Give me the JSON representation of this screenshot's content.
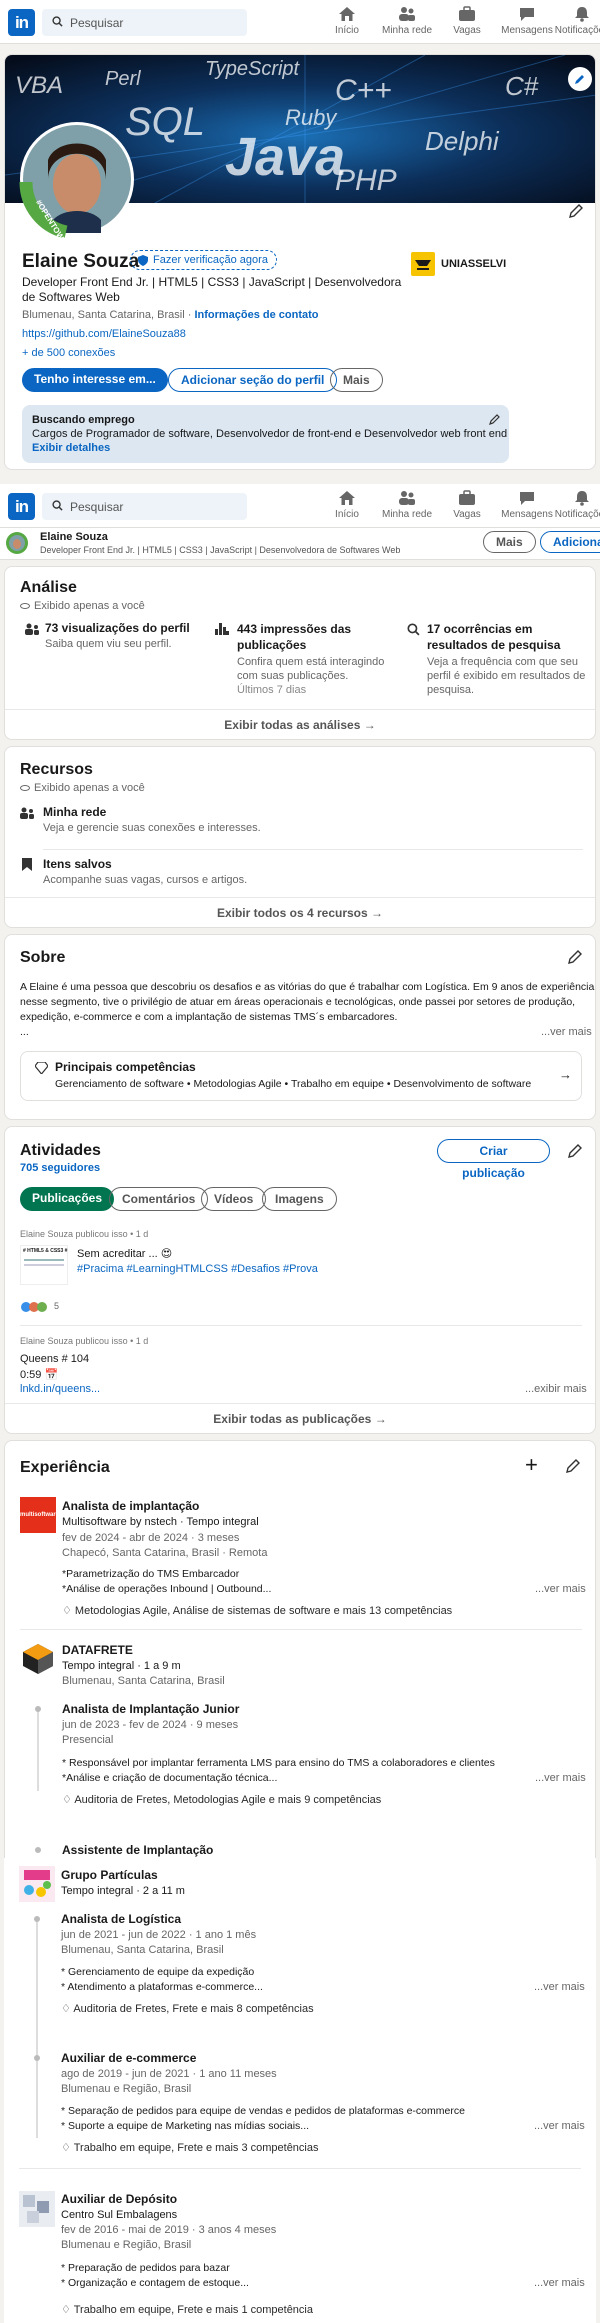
{
  "colors": {
    "brand": "#0a66c2",
    "accent_green": "#01754f",
    "background": "#f4f2ee"
  },
  "nav": {
    "logo": "in",
    "search_placeholder": "Pesquisar",
    "items": [
      {
        "label": "Início",
        "icon": "home-icon"
      },
      {
        "label": "Minha rede",
        "icon": "network-icon"
      },
      {
        "label": "Vagas",
        "icon": "briefcase-icon"
      },
      {
        "label": "Mensagens",
        "icon": "messages-icon"
      },
      {
        "label": "Notificações",
        "icon": "bell-icon"
      }
    ]
  },
  "profile": {
    "banner_words": [
      "VBA",
      "Perl",
      "TypeScript",
      "SQL",
      "Java",
      "Ruby",
      "C++",
      "PHP",
      "Delphi",
      "C#"
    ],
    "open_to_work": "#OPENTOWORK",
    "name": "Elaine Souza",
    "verify": "Fazer verificação agora",
    "headline_1": "Developer Front End Jr. | HTML5 | CSS3 | JavaScript | Desenvolvedora",
    "headline_2": "de Softwares Web",
    "location": "Blumenau, Santa Catarina, Brasil",
    "contact": "Informações de contato",
    "github": "https://github.com/ElaineSouza88",
    "connections": "+ de 500 conexões",
    "school": "UNIASSELVI",
    "btn_open": "Tenho interesse em...",
    "btn_add": "Adicionar seção do perfil",
    "btn_more": "Mais",
    "job_title": "Buscando emprego",
    "job_desc": "Cargos de Programador de software, Desenvolvedor de front-end e Desenvolvedor web front end",
    "job_link": "Exibir detalhes"
  },
  "sticky": {
    "name": "Elaine Souza",
    "headline": "Developer Front End Jr. | HTML5 | CSS3 | JavaScript | Desenvolvedora de Softwares Web",
    "more": "Mais",
    "add": "Adicionar"
  },
  "analysis": {
    "title": "Análise",
    "private": "Exibido apenas a você",
    "items": [
      {
        "title": "73 visualizações do perfil",
        "desc": "Saiba quem viu seu perfil.",
        "icon": "people-icon"
      },
      {
        "title": "443 impressões das",
        "title2": "publicações",
        "desc": "Confira quem está interagindo",
        "desc2": "com suas publicações.",
        "desc3": "Últimos 7 dias",
        "icon": "bar-chart-icon"
      },
      {
        "title": "17 ocorrências em",
        "title2": "resultados de pesquisa",
        "desc": "Veja a frequência com que seu",
        "desc2": "perfil é exibido em resultados de",
        "desc3": "pesquisa.",
        "icon": "search-icon"
      }
    ],
    "footer": "Exibir todas as análises →"
  },
  "resources": {
    "title": "Recursos",
    "private": "Exibido apenas a você",
    "items": [
      {
        "title": "Minha rede",
        "desc": "Veja e gerencie suas conexões e interesses."
      },
      {
        "title": "Itens salvos",
        "desc": "Acompanhe suas vagas, cursos e artigos."
      }
    ],
    "footer": "Exibir todos os 4 recursos →"
  },
  "about": {
    "title": "Sobre",
    "l1": "A Elaine é uma pessoa que descobriu os desafios e as vitórias do que é trabalhar com Logística. Em 9 anos de experiência",
    "l2": "nesse segmento, tive o privilégio de atuar em áreas operacionais e tecnológicas, onde passei por setores de produção,",
    "l3": "expedição, e-commerce e com a implantação de sistemas TMS´s embarcadores.",
    "l4": "...",
    "more": "...ver mais",
    "skills_title": "Principais competências",
    "skills": "Gerenciamento de software • Metodologias Agile • Trabalho em equipe • Desenvolvimento de software"
  },
  "activity": {
    "title": "Atividades",
    "followers": "705 seguidores",
    "create": "Criar publicação",
    "tabs": [
      "Publicações",
      "Comentários",
      "Vídeos",
      "Imagens"
    ],
    "p1_meta": "Elaine Souza publicou isso • 1 d",
    "p1_thumb": "# HTML5 & CSS3 #",
    "p1_text": "Sem acreditar ... 😍",
    "p1_tags": "#Pracima #LearningHTMLCSS #Desafios #Prova",
    "p1_reacts": "5",
    "p2_meta": "Elaine Souza publicou isso • 1 d",
    "p2_l1": "Queens # 104",
    "p2_l2": "0:59 📅",
    "p2_link": "lnkd.in/queens...",
    "p2_more": "...exibir mais",
    "footer": "Exibir todas as publicações →"
  },
  "experience": {
    "title": "Experiência",
    "multisoftware": {
      "logo": "multisoftware",
      "role": "Analista de implantação",
      "company": "Multisoftware by nstech · Tempo integral",
      "dates": "fev de 2024 - abr de 2024 · 3 meses",
      "place": "Chapecó, Santa Catarina, Brasil · Remota",
      "d1": "*Parametrização do TMS Embarcador",
      "d2": "*Análise de operações Inbound | Outbound...",
      "more": "...ver mais",
      "skills": "Metodologias Agile, Análise de sistemas de software e mais 13 competências"
    },
    "datafrete": {
      "company": "DATAFRETE",
      "type": "Tempo integral · 1 a 9 m",
      "place": "Blumenau, Santa Catarina, Brasil",
      "role1": "Analista de Implantação Junior",
      "dates1": "jun de 2023 - fev de 2024 · 9 meses",
      "mode1": "Presencial",
      "d1": "* Responsável por implantar ferramenta LMS para ensino do TMS a colaboradores e clientes",
      "d2": "*Análise e criação de documentação técnica...",
      "more": "...ver mais",
      "skills1": "Auditoria de Fretes, Metodologias Agile e mais 9 competências",
      "role2": "Assistente de Implantação"
    },
    "particulas": {
      "logo": "Grupo Partículas",
      "company": "Grupo Partículas",
      "type": "Tempo integral · 2 a 11 m",
      "role1": "Analista de Logística",
      "dates1": "jun de 2021 - jun de 2022 · 1 ano 1 mês",
      "place1": "Blumenau, Santa Catarina, Brasil",
      "d1a": "* Gerenciamento de equipe da expedição",
      "d1b": "* Atendimento a plataformas e-commerce...",
      "more1": "...ver mais",
      "skills1": "Auditoria de Fretes, Frete e mais 8 competências",
      "role2": "Auxiliar de e-commerce",
      "dates2": "ago de 2019 - jun de 2021 · 1 ano 11 meses",
      "place2": "Blumenau e Região, Brasil",
      "d2a": "* Separação de pedidos para equipe de vendas e pedidos de plataformas e-commerce",
      "d2b": "* Suporte a equipe de Marketing nas mídias sociais...",
      "more2": "...ver mais",
      "skills2": "Trabalho em equipe, Frete e mais 3 competências"
    },
    "deposito": {
      "role": "Auxiliar de Depósito",
      "company": "Centro Sul Embalagens",
      "dates": "fev de 2016 - mai de 2019 · 3 anos 4 meses",
      "place": "Blumenau e Região, Brasil",
      "d1": "* Preparação de pedidos para bazar",
      "d2": "* Organização e contagem de estoque...",
      "more": "...ver mais",
      "skills": "Trabalho em equipe, Frete e mais 1 competência"
    }
  }
}
